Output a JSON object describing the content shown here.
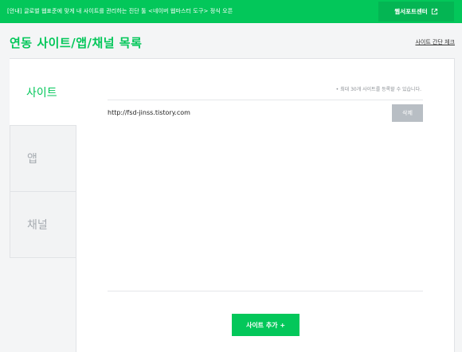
{
  "banner": {
    "text": "[안내] 글로벌 웹표준에 맞게 내 사이트를 관리하는 진단 툴 <네이버 웹마스터 도구> 정식 오픈",
    "support_button_label": "웹서포트센터",
    "support_button_icon": "external-link-icon"
  },
  "header": {
    "title": "연동 사이트/앱/채널 목록",
    "health_check_link": "사이트 간단 체크"
  },
  "tabs": [
    {
      "label": "사이트",
      "active": true
    },
    {
      "label": "앱",
      "active": false
    },
    {
      "label": "채널",
      "active": false
    }
  ],
  "site_list": {
    "notice": "• 최대 30개 사이트를 등록할 수 있습니다.",
    "items": [
      {
        "url": "http://fsd-jinss.tistory.com",
        "delete_label": "삭제"
      }
    ],
    "add_button_label": "사이트 추가 +"
  },
  "colors": {
    "brand_green": "#03c75a",
    "delete_button": "#b8bec4"
  }
}
